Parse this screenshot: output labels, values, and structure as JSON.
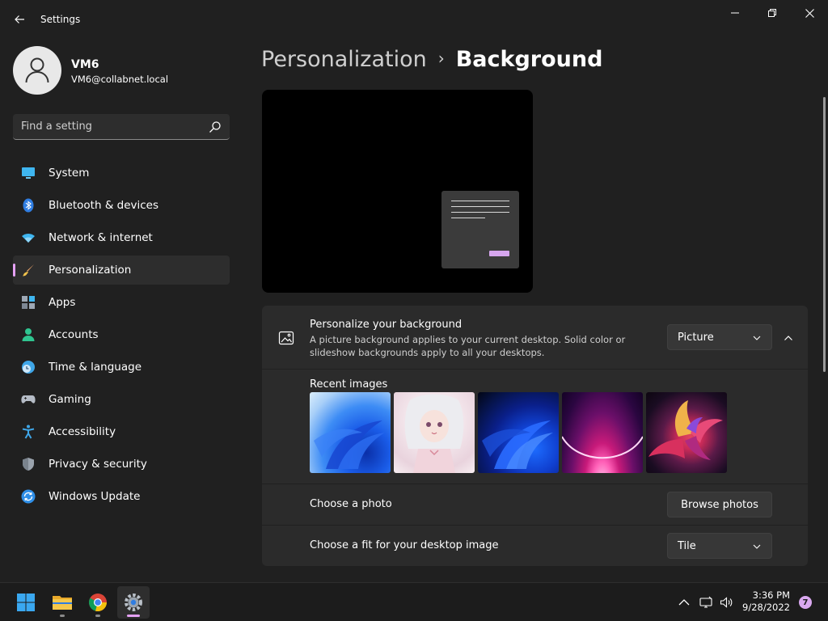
{
  "window": {
    "title": "Settings"
  },
  "user": {
    "name": "VM6",
    "email": "VM6@collabnet.local"
  },
  "search": {
    "placeholder": "Find a setting"
  },
  "sidebar": {
    "items": [
      {
        "label": "System",
        "icon": "monitor-icon",
        "active": false
      },
      {
        "label": "Bluetooth & devices",
        "icon": "bluetooth-icon",
        "active": false
      },
      {
        "label": "Network & internet",
        "icon": "wifi-icon",
        "active": false
      },
      {
        "label": "Personalization",
        "icon": "paintbrush-icon",
        "active": true
      },
      {
        "label": "Apps",
        "icon": "apps-icon",
        "active": false
      },
      {
        "label": "Accounts",
        "icon": "person-icon",
        "active": false
      },
      {
        "label": "Time & language",
        "icon": "globe-clock-icon",
        "active": false
      },
      {
        "label": "Gaming",
        "icon": "gamepad-icon",
        "active": false
      },
      {
        "label": "Accessibility",
        "icon": "accessibility-icon",
        "active": false
      },
      {
        "label": "Privacy & security",
        "icon": "shield-icon",
        "active": false
      },
      {
        "label": "Windows Update",
        "icon": "update-icon",
        "active": false
      }
    ]
  },
  "breadcrumb": {
    "parent": "Personalization",
    "separator": "›",
    "current": "Background"
  },
  "personalize": {
    "title": "Personalize your background",
    "description": "A picture background applies to your current desktop. Solid color or slideshow backgrounds apply to all your desktops.",
    "dropdown_value": "Picture"
  },
  "recent": {
    "label": "Recent images",
    "images": [
      "bloom-light",
      "anime-character",
      "bloom-dark",
      "glow-arc",
      "flower-ribbon"
    ]
  },
  "photo": {
    "label": "Choose a photo",
    "button": "Browse photos"
  },
  "fit": {
    "label": "Choose a fit for your desktop image",
    "dropdown_value": "Tile"
  },
  "taskbar": {
    "apps": [
      "start-icon",
      "file-explorer-icon",
      "chrome-icon",
      "settings-icon"
    ],
    "time": "3:36 PM",
    "date": "9/28/2022",
    "notifications": "7"
  },
  "colors": {
    "accent": "#e5a1f5",
    "background": "#202020",
    "card": "#2b2b2b"
  }
}
